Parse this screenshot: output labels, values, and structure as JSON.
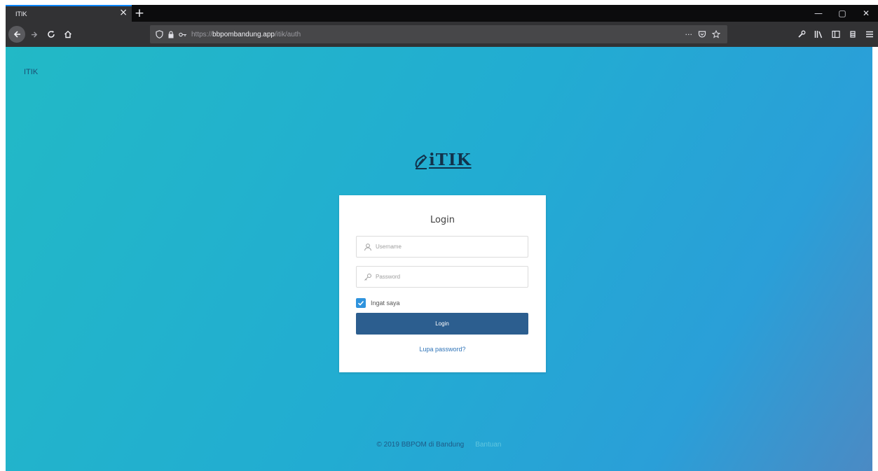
{
  "browser": {
    "tab_title": "ITIK",
    "tab_close": "×",
    "new_tab": "+",
    "url_scheme": "https://",
    "url_host": "bbpombandung.app",
    "url_path": "/itik/auth",
    "page_actions": "···",
    "window_minimize": "—",
    "window_restore": "▢",
    "window_close": "✕"
  },
  "header": {
    "brand_small": "ITIK"
  },
  "logo": {
    "text": "iTIK"
  },
  "login": {
    "title": "Login",
    "username_placeholder": "Username",
    "password_placeholder": "Password",
    "remember_label": "Ingat saya",
    "remember_checked": true,
    "submit_label": "Login",
    "forgot_label": "Lupa password?"
  },
  "footer": {
    "copyright": "© 2019 BBPOM di Bandung",
    "link": "Bantuan"
  },
  "colors": {
    "primary_button": "#2c5e8f",
    "checkbox": "#2f93dd",
    "gradient_start": "#22b9c6",
    "gradient_end": "#4b8ac4"
  }
}
